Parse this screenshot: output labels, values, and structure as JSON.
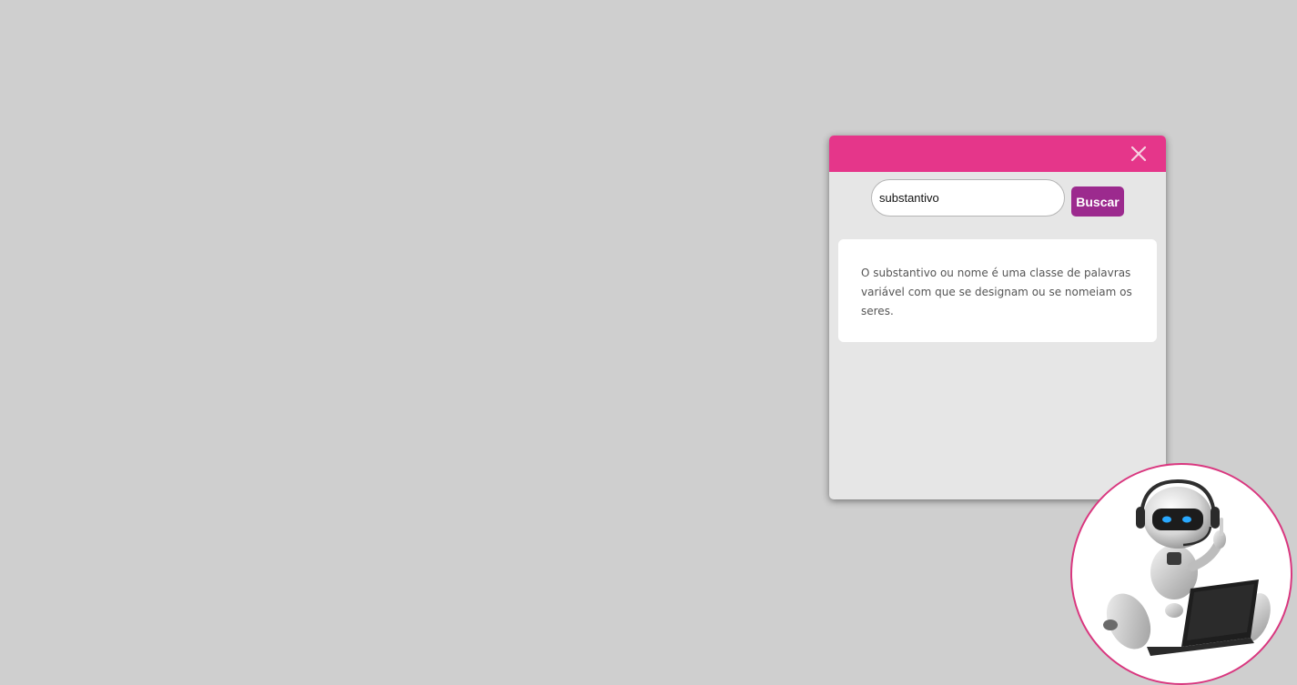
{
  "chat": {
    "close_icon": "close-icon",
    "search": {
      "value": "substantivo",
      "button_label": "Buscar"
    },
    "answer": "O substantivo ou nome é uma classe de palavras variável com que se designam ou se nomeiam os seres."
  },
  "avatar": {
    "icon": "robot-assistant-icon"
  },
  "colors": {
    "page_background": "#cfcfcf",
    "header": "#e5368a",
    "button": "#9c2a8e",
    "panel": "#e6e6e6",
    "avatar_border": "#d9377f"
  }
}
